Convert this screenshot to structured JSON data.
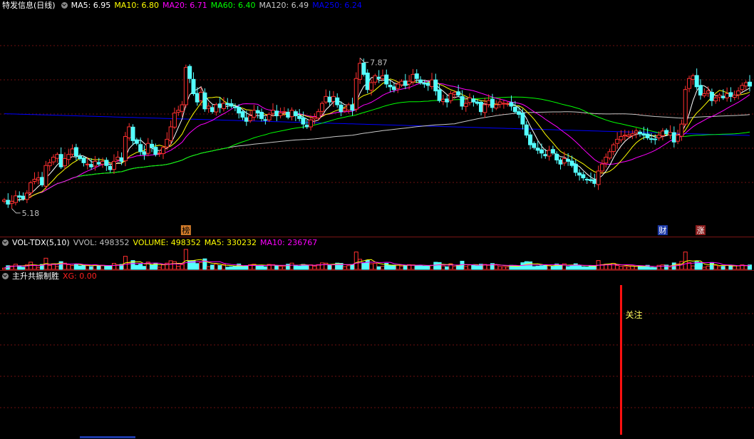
{
  "main": {
    "title": "特发信息(日线)",
    "ma_labels": [
      {
        "text": "MA5: 6.95",
        "color": "#ffffff"
      },
      {
        "text": "MA10: 6.80",
        "color": "#ffff00"
      },
      {
        "text": "MA20: 6.71",
        "color": "#ff00ff"
      },
      {
        "text": "MA60: 6.40",
        "color": "#00ff00"
      },
      {
        "text": "MA120: 6.49",
        "color": "#c8c8c8"
      },
      {
        "text": "MA250: 6.24",
        "color": "#0000ff"
      }
    ],
    "high_label": "7.87",
    "low_label": "5.18",
    "markers": [
      {
        "text": "榜",
        "bg": "#d07a2a",
        "color": "#000000",
        "bar": 48
      },
      {
        "text": "财",
        "bg": "#1d3aa8",
        "color": "#ffffff",
        "bar": 174
      },
      {
        "text": "涨",
        "bg": "#8a1c1c",
        "color": "#ffffff",
        "bar": 184
      }
    ]
  },
  "volume": {
    "title": "VOL-TDX(5,10)",
    "labels": [
      {
        "text": "VVOL: 498352",
        "color": "#c0c0c0"
      },
      {
        "text": "VOLUME: 498352",
        "color": "#ffff00"
      },
      {
        "text": "MA5: 330232",
        "color": "#ffff00"
      },
      {
        "text": "MA10: 236767",
        "color": "#ff00ff"
      }
    ]
  },
  "indicator": {
    "title": "主升共振制胜",
    "labels": [
      {
        "text": "XG: 0.00",
        "color": "#ff2020"
      }
    ],
    "signal_text": "关注",
    "signal_bar": 163
  },
  "colors": {
    "up": "#ff3030",
    "down": "#54ffff",
    "grid": "#6e0f0f"
  },
  "chart_data": {
    "type": "candlestick",
    "title": "特发信息(日线)",
    "annotations": [
      "7.87",
      "5.18"
    ],
    "ma_lines": {
      "MA5": 6.95,
      "MA10": 6.8,
      "MA20": 6.71,
      "MA60": 6.4,
      "MA120": 6.49,
      "MA250": 6.24
    },
    "close": [
      5.3,
      5.24,
      5.28,
      5.36,
      5.34,
      5.32,
      5.4,
      5.55,
      5.6,
      5.62,
      5.52,
      5.8,
      5.84,
      5.92,
      5.96,
      5.78,
      5.9,
      5.96,
      6.04,
      5.94,
      5.9,
      5.84,
      5.82,
      5.78,
      5.86,
      5.82,
      5.86,
      5.8,
      5.74,
      5.86,
      5.92,
      5.86,
      6.22,
      6.36,
      6.16,
      6.12,
      6.0,
      5.96,
      6.12,
      6.06,
      5.96,
      5.98,
      6.06,
      6.18,
      6.36,
      6.56,
      6.6,
      6.68,
      7.22,
      7.06,
      6.84,
      6.72,
      6.86,
      6.62,
      6.66,
      6.58,
      6.68,
      6.64,
      6.7,
      6.68,
      6.66,
      6.64,
      6.56,
      6.5,
      6.44,
      6.52,
      6.6,
      6.56,
      6.48,
      6.46,
      6.54,
      6.6,
      6.52,
      6.56,
      6.58,
      6.5,
      6.6,
      6.52,
      6.48,
      6.4,
      6.36,
      6.46,
      6.5,
      6.58,
      6.7,
      6.8,
      6.72,
      6.8,
      6.68,
      6.58,
      6.62,
      6.68,
      6.6,
      7.06,
      7.28,
      7.12,
      6.9,
      7.0,
      7.1,
      7.06,
      7.1,
      6.98,
      6.94,
      6.9,
      6.98,
      7.02,
      6.96,
      7.02,
      7.12,
      7.06,
      7.0,
      6.98,
      6.96,
      7.04,
      6.88,
      6.74,
      6.76,
      6.72,
      6.84,
      6.86,
      6.82,
      6.66,
      6.7,
      6.78,
      6.72,
      6.7,
      6.58,
      6.68,
      6.74,
      6.64,
      6.68,
      6.72,
      6.7,
      6.7,
      6.66,
      6.58,
      6.54,
      6.4,
      6.24,
      6.1,
      6.06,
      6.02,
      5.98,
      5.94,
      6.02,
      5.98,
      5.88,
      5.82,
      5.9,
      5.86,
      5.8,
      5.7,
      5.66,
      5.62,
      5.6,
      5.58,
      5.54,
      5.72,
      5.82,
      5.92,
      6.0,
      6.1,
      6.18,
      6.22,
      6.24,
      6.24,
      6.26,
      6.3,
      6.26,
      6.24,
      6.2,
      6.18,
      6.18,
      6.24,
      6.3,
      6.26,
      6.28,
      6.14,
      6.24,
      6.4,
      6.9,
      7.06,
      7.1,
      6.94,
      6.82,
      6.84,
      6.88,
      6.74,
      6.78,
      6.82,
      6.78,
      6.84,
      6.8,
      6.82,
      6.88,
      6.96,
      7.0,
      6.95
    ]
  }
}
